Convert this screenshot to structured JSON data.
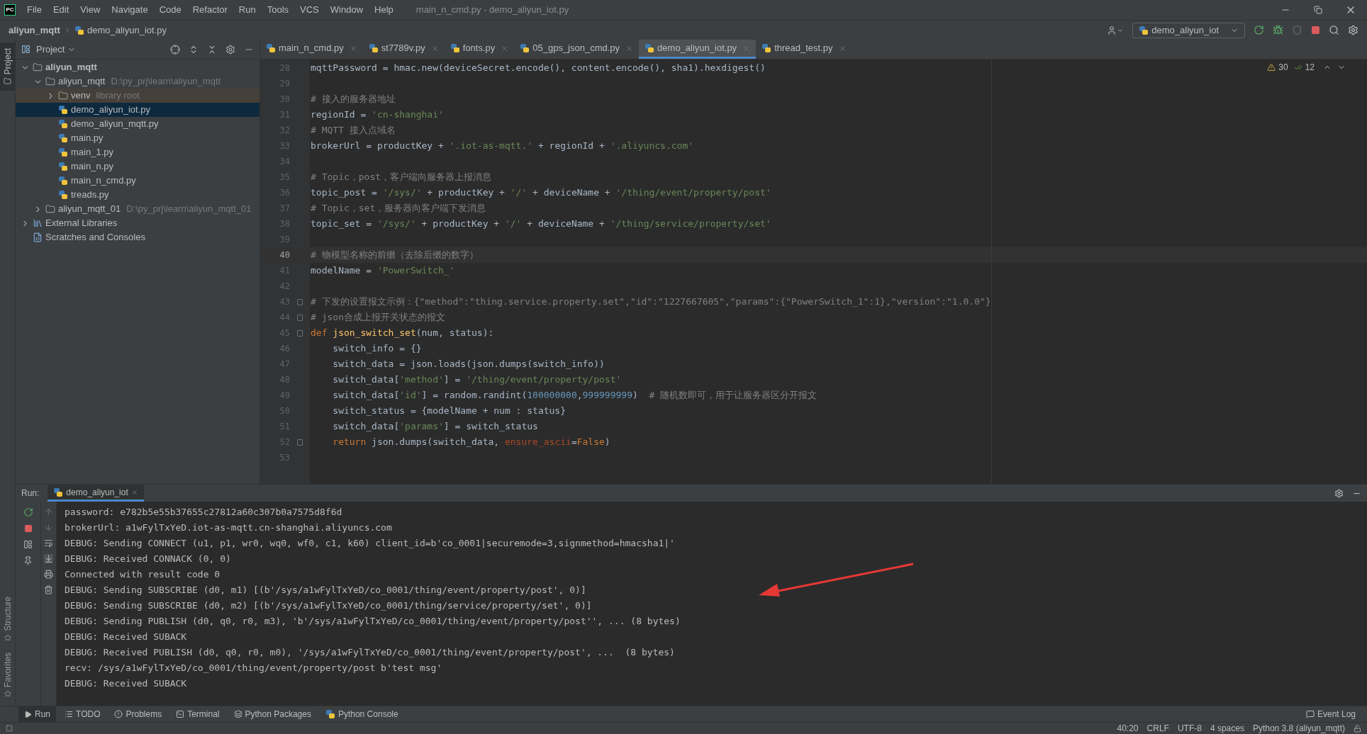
{
  "window": {
    "logo_text": "PC",
    "title": "main_n_cmd.py - demo_aliyun_iot.py"
  },
  "menu": [
    "File",
    "Edit",
    "View",
    "Navigate",
    "Code",
    "Refactor",
    "Run",
    "Tools",
    "VCS",
    "Window",
    "Help"
  ],
  "breadcrumb": [
    "aliyun_mqtt",
    "demo_aliyun_iot.py"
  ],
  "run_config": "demo_aliyun_iot",
  "left_strip": [
    {
      "label": "Project",
      "kind": "top",
      "selected": true
    },
    {
      "label": "Structure",
      "kind": "bottom",
      "selected": false
    },
    {
      "label": "Favorites",
      "kind": "bottom",
      "selected": false
    }
  ],
  "project": {
    "title": "Project",
    "tree": [
      {
        "name": "aliyun_mqtt",
        "kind": "project",
        "expanded": true,
        "selected": false,
        "children": [
          {
            "name": "aliyun_mqtt",
            "kind": "folder",
            "hint": "D:\\py_prj\\learn\\aliyun_mqtt",
            "expanded": true,
            "selected": false,
            "children": [
              {
                "name": "venv",
                "kind": "library",
                "hint": "library root",
                "expanded": false,
                "selected": false
              },
              {
                "name": "demo_aliyun_iot.py",
                "kind": "file",
                "selected": true
              },
              {
                "name": "demo_aliyun_mqtt.py",
                "kind": "file",
                "selected": false
              },
              {
                "name": "main.py",
                "kind": "file",
                "selected": false
              },
              {
                "name": "main_1.py",
                "kind": "file",
                "selected": false
              },
              {
                "name": "main_n.py",
                "kind": "file",
                "selected": false
              },
              {
                "name": "main_n_cmd.py",
                "kind": "file",
                "selected": false
              },
              {
                "name": "treads.py",
                "kind": "file",
                "selected": false
              }
            ]
          },
          {
            "name": "aliyun_mqtt_01",
            "kind": "folder",
            "hint": "D:\\py_prj\\learn\\aliyun_mqtt_01",
            "expanded": false,
            "selected": false
          }
        ]
      },
      {
        "name": "External Libraries",
        "kind": "libraries",
        "expanded": false,
        "selected": false
      },
      {
        "name": "Scratches and Consoles",
        "kind": "scratches",
        "selected": false
      }
    ]
  },
  "tabs": [
    {
      "label": "main_n_cmd.py",
      "selected": false
    },
    {
      "label": "st7789v.py",
      "selected": false
    },
    {
      "label": "fonts.py",
      "selected": false
    },
    {
      "label": "05_gps_json_cmd.py",
      "selected": false
    },
    {
      "label": "demo_aliyun_iot.py",
      "selected": true
    },
    {
      "label": "thread_test.py",
      "selected": false
    }
  ],
  "inspections": {
    "warnings": "30",
    "weak_warnings": "12"
  },
  "code": [
    {
      "number": "28",
      "current": false,
      "tokens": [
        {
          "kind": "plain",
          "text": "mqttPassword = hmac.new(deviceSecret.encode(), content.encode(), sha1).hexdigest()"
        }
      ]
    },
    {
      "number": "29",
      "current": false
    },
    {
      "number": "30",
      "current": false,
      "tokens": [
        {
          "kind": "comment",
          "text": "# 接入的服务器地址"
        }
      ]
    },
    {
      "number": "31",
      "current": false,
      "tokens": [
        {
          "kind": "plain",
          "text": "regionId = "
        },
        {
          "kind": "string",
          "text": "'cn-shanghai'"
        }
      ]
    },
    {
      "number": "32",
      "current": false,
      "tokens": [
        {
          "kind": "comment",
          "text": "# MQTT 接入点域名"
        }
      ]
    },
    {
      "number": "33",
      "current": false,
      "tokens": [
        {
          "kind": "plain",
          "text": "brokerUrl = productKey + "
        },
        {
          "kind": "string",
          "text": "'.iot-as-mqtt.'"
        },
        {
          "kind": "plain",
          "text": " + regionId + "
        },
        {
          "kind": "string",
          "text": "'.aliyuncs.com'"
        }
      ]
    },
    {
      "number": "34",
      "current": false
    },
    {
      "number": "35",
      "current": false,
      "tokens": [
        {
          "kind": "comment",
          "text": "# Topic，post，客户端向服务器上报消息"
        }
      ]
    },
    {
      "number": "36",
      "current": false,
      "tokens": [
        {
          "kind": "plain",
          "text": "topic_post = "
        },
        {
          "kind": "string",
          "text": "'/sys/'"
        },
        {
          "kind": "plain",
          "text": " + productKey + "
        },
        {
          "kind": "string",
          "text": "'/'"
        },
        {
          "kind": "plain",
          "text": " + deviceName + "
        },
        {
          "kind": "string",
          "text": "'/thing/event/property/post'"
        }
      ]
    },
    {
      "number": "37",
      "current": false,
      "tokens": [
        {
          "kind": "comment",
          "text": "# Topic，set，服务器向客户端下发消息"
        }
      ]
    },
    {
      "number": "38",
      "current": false,
      "tokens": [
        {
          "kind": "plain",
          "text": "topic_set = "
        },
        {
          "kind": "string",
          "text": "'/sys/'"
        },
        {
          "kind": "plain",
          "text": " + productKey + "
        },
        {
          "kind": "string",
          "text": "'/'"
        },
        {
          "kind": "plain",
          "text": " + deviceName + "
        },
        {
          "kind": "string",
          "text": "'/thing/service/property/set'"
        }
      ]
    },
    {
      "number": "39",
      "current": false
    },
    {
      "number": "40",
      "current": true,
      "tokens": [
        {
          "kind": "comment",
          "text": "# 物模型名称的前缀（去除后缀的数字）"
        }
      ]
    },
    {
      "number": "41",
      "current": false,
      "tokens": [
        {
          "kind": "plain",
          "text": "modelName = "
        },
        {
          "kind": "string",
          "text": "'PowerSwitch_'"
        }
      ]
    },
    {
      "number": "42",
      "current": false
    },
    {
      "number": "43",
      "current": false,
      "fold": true,
      "tokens": [
        {
          "kind": "comment",
          "text": "# 下发的设置报文示例：{\"method\":\"thing.service.property.set\",\"id\":\"1227667605\",\"params\":{\"PowerSwitch_1\":1},\"version\":\"1.0.0\"}"
        }
      ]
    },
    {
      "number": "44",
      "current": false,
      "fold": true,
      "tokens": [
        {
          "kind": "comment",
          "text": "# json合成上报开关状态的报文"
        }
      ]
    },
    {
      "number": "45",
      "current": false,
      "fold": true,
      "tokens": [
        {
          "kind": "keyword",
          "text": "def "
        },
        {
          "kind": "function",
          "text": "json_switch_set"
        },
        {
          "kind": "plain",
          "text": "(num, status):"
        }
      ]
    },
    {
      "number": "46",
      "current": false,
      "tokens": [
        {
          "kind": "plain",
          "text": "    switch_info = {}"
        }
      ]
    },
    {
      "number": "47",
      "current": false,
      "tokens": [
        {
          "kind": "plain",
          "text": "    switch_data = json.loads(json.dumps(switch_info))"
        }
      ]
    },
    {
      "number": "48",
      "current": false,
      "tokens": [
        {
          "kind": "plain",
          "text": "    switch_data["
        },
        {
          "kind": "string",
          "text": "'method'"
        },
        {
          "kind": "plain",
          "text": "] = "
        },
        {
          "kind": "string",
          "text": "'/thing/event/property/post'"
        }
      ]
    },
    {
      "number": "49",
      "current": false,
      "tokens": [
        {
          "kind": "plain",
          "text": "    switch_data["
        },
        {
          "kind": "string",
          "text": "'id'"
        },
        {
          "kind": "plain",
          "text": "] = random.randint("
        },
        {
          "kind": "number",
          "text": "100000000"
        },
        {
          "kind": "plain",
          "text": ","
        },
        {
          "kind": "number",
          "text": "999999999"
        },
        {
          "kind": "plain",
          "text": ")  "
        },
        {
          "kind": "comment",
          "text": "# 随机数即可，用于让服务器区分开报文"
        }
      ]
    },
    {
      "number": "50",
      "current": false,
      "tokens": [
        {
          "kind": "plain",
          "text": "    switch_status = {modelName + num : status}"
        }
      ]
    },
    {
      "number": "51",
      "current": false,
      "tokens": [
        {
          "kind": "plain",
          "text": "    switch_data["
        },
        {
          "kind": "string",
          "text": "'params'"
        },
        {
          "kind": "plain",
          "text": "] = switch_status"
        }
      ]
    },
    {
      "number": "52",
      "current": false,
      "fold": true,
      "tokens": [
        {
          "kind": "keyword",
          "text": "    return"
        },
        {
          "kind": "plain",
          "text": " json.dumps(switch_data, "
        },
        {
          "kind": "param",
          "text": "ensure_ascii"
        },
        {
          "kind": "plain",
          "text": "="
        },
        {
          "kind": "keyword",
          "text": "False"
        },
        {
          "kind": "plain",
          "text": ")"
        }
      ]
    },
    {
      "number": "53",
      "current": false
    }
  ],
  "run": {
    "label": "Run:",
    "tab": "demo_aliyun_iot",
    "output": [
      "password: e782b5e55b37655c27812a60c307b0a7575d8f6d",
      "brokerUrl: a1wFylTxYeD.iot-as-mqtt.cn-shanghai.aliyuncs.com",
      "DEBUG: Sending CONNECT (u1, p1, wr0, wq0, wf0, c1, k60) client_id=b'co_0001|securemode=3,signmethod=hmacsha1|'",
      "DEBUG: Received CONNACK (0, 0)",
      "Connected with result code 0",
      "DEBUG: Sending SUBSCRIBE (d0, m1) [(b'/sys/a1wFylTxYeD/co_0001/thing/event/property/post', 0)]",
      "DEBUG: Sending SUBSCRIBE (d0, m2) [(b'/sys/a1wFylTxYeD/co_0001/thing/service/property/set', 0)]",
      "DEBUG: Sending PUBLISH (d0, q0, r0, m3), 'b'/sys/a1wFylTxYeD/co_0001/thing/event/property/post'', ... (8 bytes)",
      "DEBUG: Received SUBACK",
      "DEBUG: Received PUBLISH (d0, q0, r0, m0), '/sys/a1wFylTxYeD/co_0001/thing/event/property/post', ...  (8 bytes)",
      "recv: /sys/a1wFylTxYeD/co_0001/thing/event/property/post b'test msg'",
      "DEBUG: Received SUBACK"
    ]
  },
  "tool_windows": [
    {
      "label": "Run",
      "kind": "run",
      "selected": true
    },
    {
      "label": "TODO",
      "kind": "todo",
      "selected": false
    },
    {
      "label": "Problems",
      "kind": "problems",
      "selected": false
    },
    {
      "label": "Terminal",
      "kind": "terminal",
      "selected": false
    },
    {
      "label": "Python Packages",
      "kind": "packages",
      "selected": false
    },
    {
      "label": "Python Console",
      "kind": "console",
      "selected": false
    }
  ],
  "event_log": "Event Log",
  "status_bar": [
    "40:20",
    "CRLF",
    "UTF-8",
    "4 spaces",
    "Python 3.8 (aliyun_mqtt)"
  ]
}
